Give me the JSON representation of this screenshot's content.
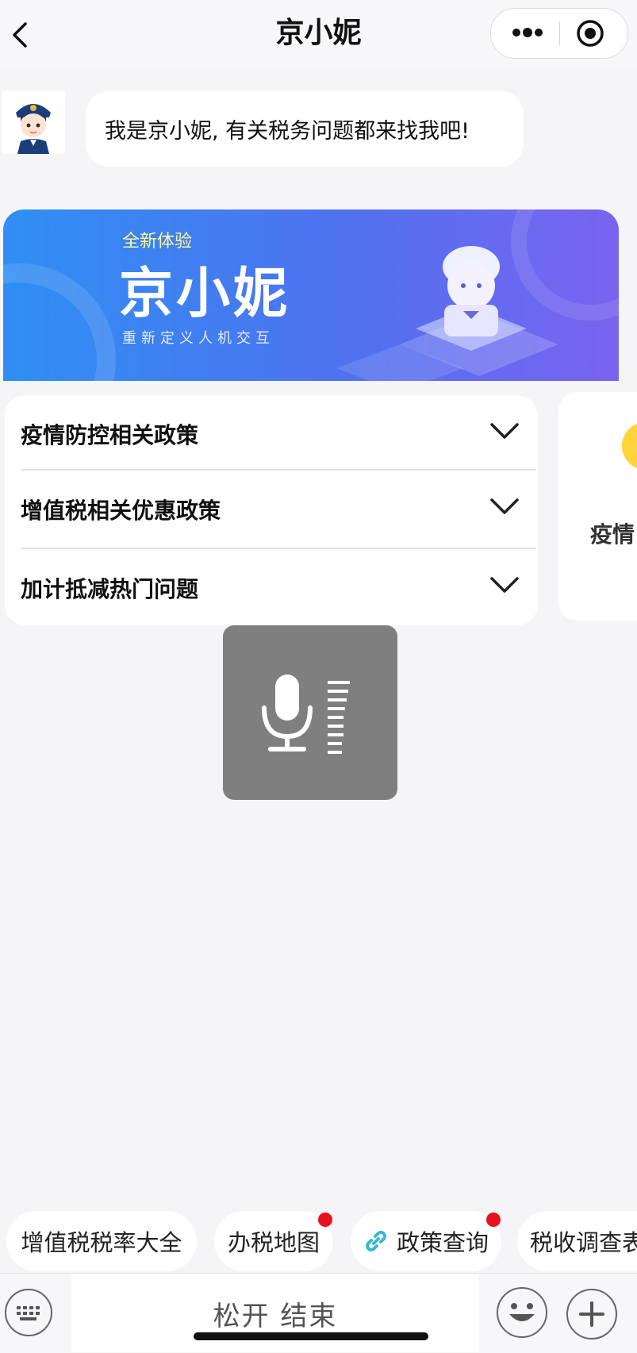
{
  "nav": {
    "title": "京小妮"
  },
  "chat": {
    "greeting": "我是京小妮, 有关税务问题都来找我吧!"
  },
  "banner": {
    "subtitle": "全新体验",
    "title": "京小妮",
    "tagline": "重新定义人机交互"
  },
  "faq": {
    "items": [
      {
        "label": "疫情防控相关政策"
      },
      {
        "label": "增值税相关优惠政策"
      },
      {
        "label": "加计抵减热门问题"
      }
    ]
  },
  "side_card": {
    "label": "疫情"
  },
  "chips": [
    {
      "label": "增值税税率大全",
      "badge": false,
      "icon": ""
    },
    {
      "label": "办税地图",
      "badge": true,
      "icon": ""
    },
    {
      "label": "政策查询",
      "badge": true,
      "icon": "link-icon"
    },
    {
      "label": "税收调查表",
      "badge": false,
      "icon": ""
    }
  ],
  "input": {
    "hold_label": "松开 结束"
  },
  "colors": {
    "badge": "#e5131d",
    "accent_link": "#39b7d8",
    "banner_start": "#2f8ff3",
    "banner_end": "#7a63f0"
  }
}
